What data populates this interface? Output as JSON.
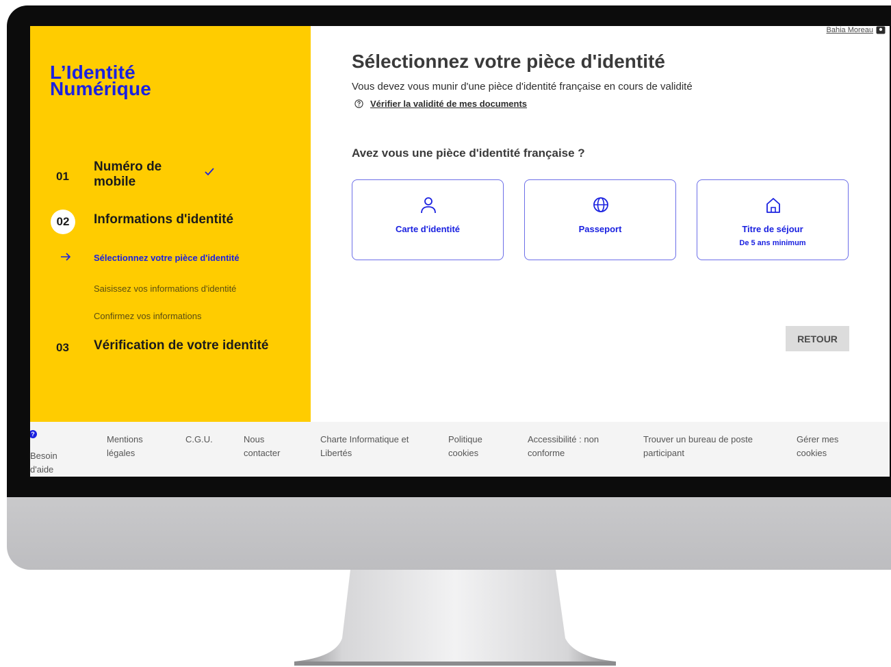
{
  "user": {
    "name": "Bahia Moreau"
  },
  "logo": {
    "line1": "L’Identité",
    "line2": "Numérique"
  },
  "steps": [
    {
      "number": "01",
      "title": "Numéro de mobile",
      "status": "done"
    },
    {
      "number": "02",
      "title": "Informations d'identité",
      "status": "current",
      "substeps": [
        {
          "label": "Sélectionnez votre pièce d'identité",
          "active": true
        },
        {
          "label": "Saisissez vos informations d'identité",
          "active": false
        },
        {
          "label": "Confirmez vos informations",
          "active": false
        }
      ]
    },
    {
      "number": "03",
      "title": "Vérification de votre identité",
      "status": "pending"
    }
  ],
  "main": {
    "title": "Sélectionnez votre pièce d'identité",
    "subtitle": "Vous devez vous munir d'une pièce d'identité française en cours de validité",
    "validity_link": "Vérifier la validité de mes documents",
    "question": "Avez vous une pièce d'identité française ?",
    "options": [
      {
        "label": "Carte d'identité",
        "sub": "",
        "icon": "person-icon"
      },
      {
        "label": "Passeport",
        "sub": "",
        "icon": "globe-icon"
      },
      {
        "label": "Titre de séjour",
        "sub": "De 5 ans minimum",
        "icon": "home-icon"
      }
    ],
    "back_button": "RETOUR"
  },
  "footer": {
    "help": "Besoin d'aide",
    "links": [
      "Mentions légales",
      "C.G.U.",
      "Nous contacter",
      "Charte Informatique et Libertés",
      "Politique cookies",
      "Accessibilité : non conforme",
      "Trouver un bureau de poste participant",
      "Gérer mes cookies"
    ]
  },
  "colors": {
    "brand_yellow": "#ffcc00",
    "brand_blue": "#1a21e0",
    "card_border": "#6b6ee8",
    "button_gray": "#dcdcdc"
  }
}
